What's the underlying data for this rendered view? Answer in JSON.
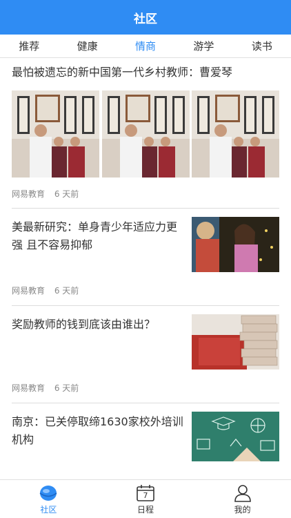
{
  "header": {
    "title": "社区"
  },
  "tabs": [
    {
      "label": "推荐"
    },
    {
      "label": "健康"
    },
    {
      "label": "情商"
    },
    {
      "label": "游学"
    },
    {
      "label": "读书"
    }
  ],
  "active_tab": "情商",
  "articles": [
    {
      "title": "最怕被遗忘的新中国第一代乡村教师：曹爱琴",
      "source": "网易教育",
      "time": "6 天前"
    },
    {
      "title": "美最新研究：单身青少年适应力更强 且不容易抑郁",
      "source": "网易教育",
      "time": "6 天前"
    },
    {
      "title": "奖励教师的钱到底该由谁出？",
      "source": "网易教育",
      "time": "6 天前"
    },
    {
      "title": "南京：已关停取缔1630家校外培训机构",
      "source": "",
      "time": ""
    }
  ],
  "bottom_nav": [
    {
      "label": "社区",
      "icon": "community-icon"
    },
    {
      "label": "日程",
      "icon": "calendar-icon",
      "badge": "7"
    },
    {
      "label": "我的",
      "icon": "user-icon"
    }
  ],
  "colors": {
    "accent": "#2f8cf3",
    "text": "#333333",
    "meta": "#888888"
  }
}
